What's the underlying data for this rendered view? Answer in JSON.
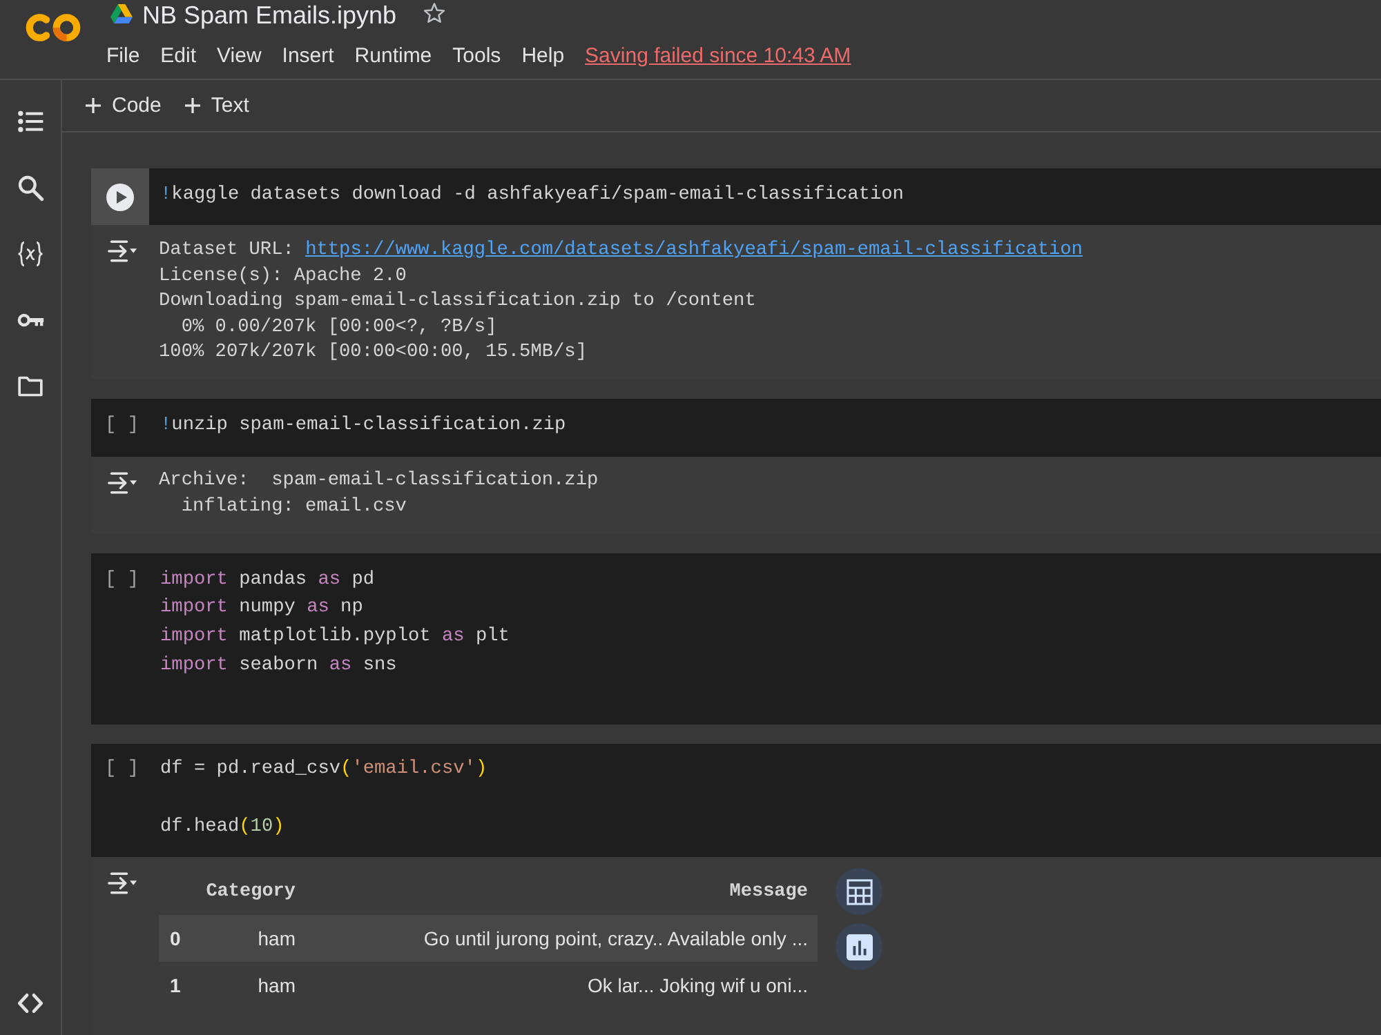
{
  "header": {
    "title": "NB Spam Emails.ipynb",
    "starred": false,
    "menu": [
      "File",
      "Edit",
      "View",
      "Insert",
      "Runtime",
      "Tools",
      "Help"
    ],
    "save_status": "Saving failed since 10:43 AM"
  },
  "toolbar": {
    "buttons": [
      "Code",
      "Text"
    ]
  },
  "cells": [
    {
      "focused": true,
      "code": [
        {
          "kind": "code",
          "tokens": [
            {
              "kind": "shell",
              "text": "!"
            },
            {
              "kind": "plain",
              "text": "kaggle datasets download -d ashfakyeafi/spam-email-classification"
            }
          ]
        }
      ],
      "output": {
        "kind": "text",
        "lines": [
          [
            {
              "kind": "plain",
              "text": "Dataset URL: "
            },
            {
              "kind": "link",
              "text": "https://www.kaggle.com/datasets/ashfakyeafi/spam-email-classification"
            }
          ],
          [
            {
              "kind": "plain",
              "text": "License(s): Apache 2.0"
            }
          ],
          [
            {
              "kind": "plain",
              "text": "Downloading spam-email-classification.zip to /content"
            }
          ],
          [
            {
              "kind": "plain",
              "text": "  0% 0.00/207k [00:00<?, ?B/s]"
            }
          ],
          [
            {
              "kind": "plain",
              "text": "100% 207k/207k [00:00<00:00, 15.5MB/s]"
            }
          ]
        ]
      }
    },
    {
      "focused": false,
      "prompt": "[ ]",
      "code": [
        {
          "kind": "code",
          "tokens": [
            {
              "kind": "shell",
              "text": "!"
            },
            {
              "kind": "plain",
              "text": "unzip spam-email-classification.zip"
            }
          ]
        }
      ],
      "output": {
        "kind": "text",
        "lines": [
          [
            {
              "kind": "plain",
              "text": "Archive:  spam-email-classification.zip"
            }
          ],
          [
            {
              "kind": "plain",
              "text": "  inflating: email.csv"
            }
          ]
        ]
      }
    },
    {
      "focused": false,
      "prompt": "[ ]",
      "code": [
        {
          "kind": "code",
          "tokens": [
            {
              "kind": "keyword",
              "text": "import"
            },
            {
              "kind": "plain",
              "text": " pandas "
            },
            {
              "kind": "keyword",
              "text": "as"
            },
            {
              "kind": "plain",
              "text": " pd"
            }
          ]
        },
        {
          "kind": "code",
          "tokens": [
            {
              "kind": "keyword",
              "text": "import"
            },
            {
              "kind": "plain",
              "text": " numpy "
            },
            {
              "kind": "keyword",
              "text": "as"
            },
            {
              "kind": "plain",
              "text": " np"
            }
          ]
        },
        {
          "kind": "code",
          "tokens": [
            {
              "kind": "keyword",
              "text": "import"
            },
            {
              "kind": "plain",
              "text": " matplotlib.pyplot "
            },
            {
              "kind": "keyword",
              "text": "as"
            },
            {
              "kind": "plain",
              "text": " plt"
            }
          ]
        },
        {
          "kind": "code",
          "tokens": [
            {
              "kind": "keyword",
              "text": "import"
            },
            {
              "kind": "plain",
              "text": " seaborn "
            },
            {
              "kind": "keyword",
              "text": "as"
            },
            {
              "kind": "plain",
              "text": " sns"
            }
          ]
        },
        {
          "kind": "blank"
        }
      ]
    },
    {
      "focused": false,
      "prompt": "[ ]",
      "code": [
        {
          "kind": "code",
          "tokens": [
            {
              "kind": "plain",
              "text": "df = pd.read_csv"
            },
            {
              "kind": "bracket",
              "text": "("
            },
            {
              "kind": "string",
              "text": "'email.csv'"
            },
            {
              "kind": "bracket",
              "text": ")"
            }
          ]
        },
        {
          "kind": "blank"
        },
        {
          "kind": "code",
          "tokens": [
            {
              "kind": "plain",
              "text": "df.head"
            },
            {
              "kind": "bracket",
              "text": "("
            },
            {
              "kind": "number",
              "text": "10"
            },
            {
              "kind": "bracket",
              "text": ")"
            }
          ]
        }
      ],
      "output": {
        "kind": "table",
        "columns": [
          "Category",
          "Message"
        ],
        "rows": [
          {
            "index": "0",
            "values": [
              "ham",
              "Go until jurong point, crazy.. Available only ..."
            ]
          },
          {
            "index": "1",
            "values": [
              "ham",
              "Ok lar... Joking wif u oni..."
            ]
          }
        ]
      }
    }
  ]
}
